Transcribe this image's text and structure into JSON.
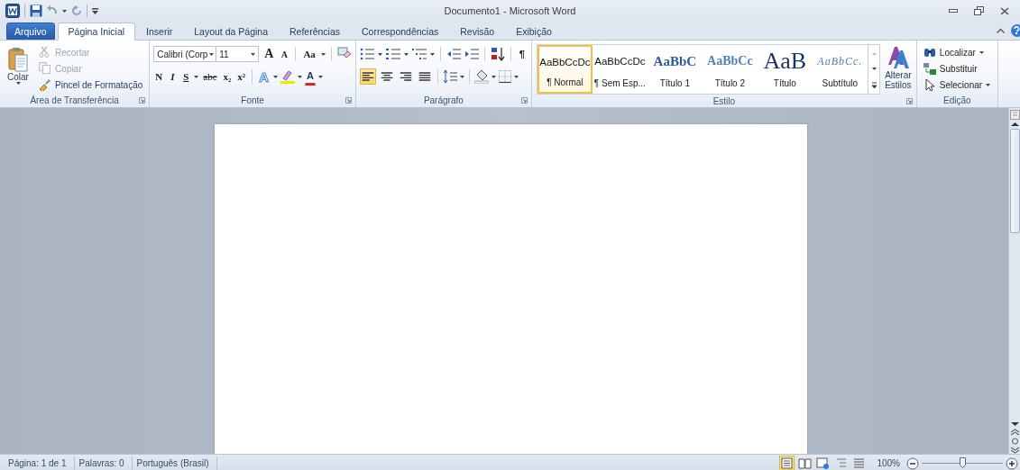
{
  "window": {
    "title": "Documento1 - Microsoft Word"
  },
  "tabs": [
    {
      "label": "Arquivo",
      "kind": "file",
      "selected": false
    },
    {
      "label": "Página Inicial",
      "kind": "tab",
      "selected": true
    },
    {
      "label": "Inserir",
      "kind": "tab",
      "selected": false
    },
    {
      "label": "Layout da Página",
      "kind": "tab",
      "selected": false
    },
    {
      "label": "Referências",
      "kind": "tab",
      "selected": false
    },
    {
      "label": "Correspondências",
      "kind": "tab",
      "selected": false
    },
    {
      "label": "Revisão",
      "kind": "tab",
      "selected": false
    },
    {
      "label": "Exibição",
      "kind": "tab",
      "selected": false
    }
  ],
  "ribbon": {
    "clipboard": {
      "paste": "Colar",
      "group": "Área de Transferência",
      "items": [
        {
          "label": "Recortar",
          "kind": "cut",
          "disabled": true
        },
        {
          "label": "Copiar",
          "kind": "copy",
          "disabled": true
        },
        {
          "label": "Pincel de Formatação",
          "kind": "brush",
          "disabled": false
        }
      ]
    },
    "font": {
      "group": "Fonte",
      "name": "Calibri (Corp",
      "size": "11",
      "grow": "A",
      "shrink": "A",
      "case": "Aa",
      "format_buttons": [
        {
          "label": "N",
          "kind": "bold"
        },
        {
          "label": "I",
          "kind": "italic"
        },
        {
          "label": "S",
          "kind": "underline"
        },
        {
          "label": "abc",
          "kind": "strike"
        },
        {
          "label": "x₂",
          "kind": "sub"
        },
        {
          "label": "x²",
          "kind": "sup"
        }
      ],
      "effect": "A",
      "color_letter": "A"
    },
    "paragraph": {
      "group": "Parágrafo",
      "pilcrow": "¶",
      "alignments": [
        {
          "kind": "left",
          "selected": true
        },
        {
          "kind": "center",
          "selected": false
        },
        {
          "kind": "right",
          "selected": false
        },
        {
          "kind": "justify",
          "selected": false
        }
      ]
    },
    "styles": {
      "group": "Estilo",
      "change": "Alterar Estilos",
      "items": [
        {
          "preview": "AaBbCcDc",
          "label": "¶ Normal",
          "kind": "normal",
          "selected": true
        },
        {
          "preview": "AaBbCcDc",
          "label": "¶ Sem Esp...",
          "kind": "plain",
          "selected": false
        },
        {
          "preview": "AaBbC",
          "label": "Título 1",
          "kind": "h1",
          "selected": false
        },
        {
          "preview": "AaBbCc",
          "label": "Título 2",
          "kind": "h2",
          "selected": false
        },
        {
          "preview": "AaB",
          "label": "Título",
          "kind": "title",
          "selected": false
        },
        {
          "preview": "AaBbCc.",
          "label": "Subtítulo",
          "kind": "subtitle",
          "selected": false
        }
      ]
    },
    "editing": {
      "group": "Edição",
      "items": [
        {
          "label": "Localizar",
          "kind": "find",
          "menu": true
        },
        {
          "label": "Substituir",
          "kind": "replace",
          "menu": false
        },
        {
          "label": "Selecionar",
          "kind": "select",
          "menu": true
        }
      ]
    }
  },
  "status_bar": {
    "items": [
      "Página: 1 de 1",
      "Palavras: 0",
      "Português (Brasil)"
    ],
    "views": [
      {
        "kind": "print",
        "selected": true
      },
      {
        "kind": "read",
        "selected": false
      },
      {
        "kind": "web",
        "selected": false
      },
      {
        "kind": "outline",
        "selected": false
      },
      {
        "kind": "draft",
        "selected": false
      }
    ],
    "zoom": "100%",
    "zoom_slider": {
      "level": 0.5
    }
  }
}
